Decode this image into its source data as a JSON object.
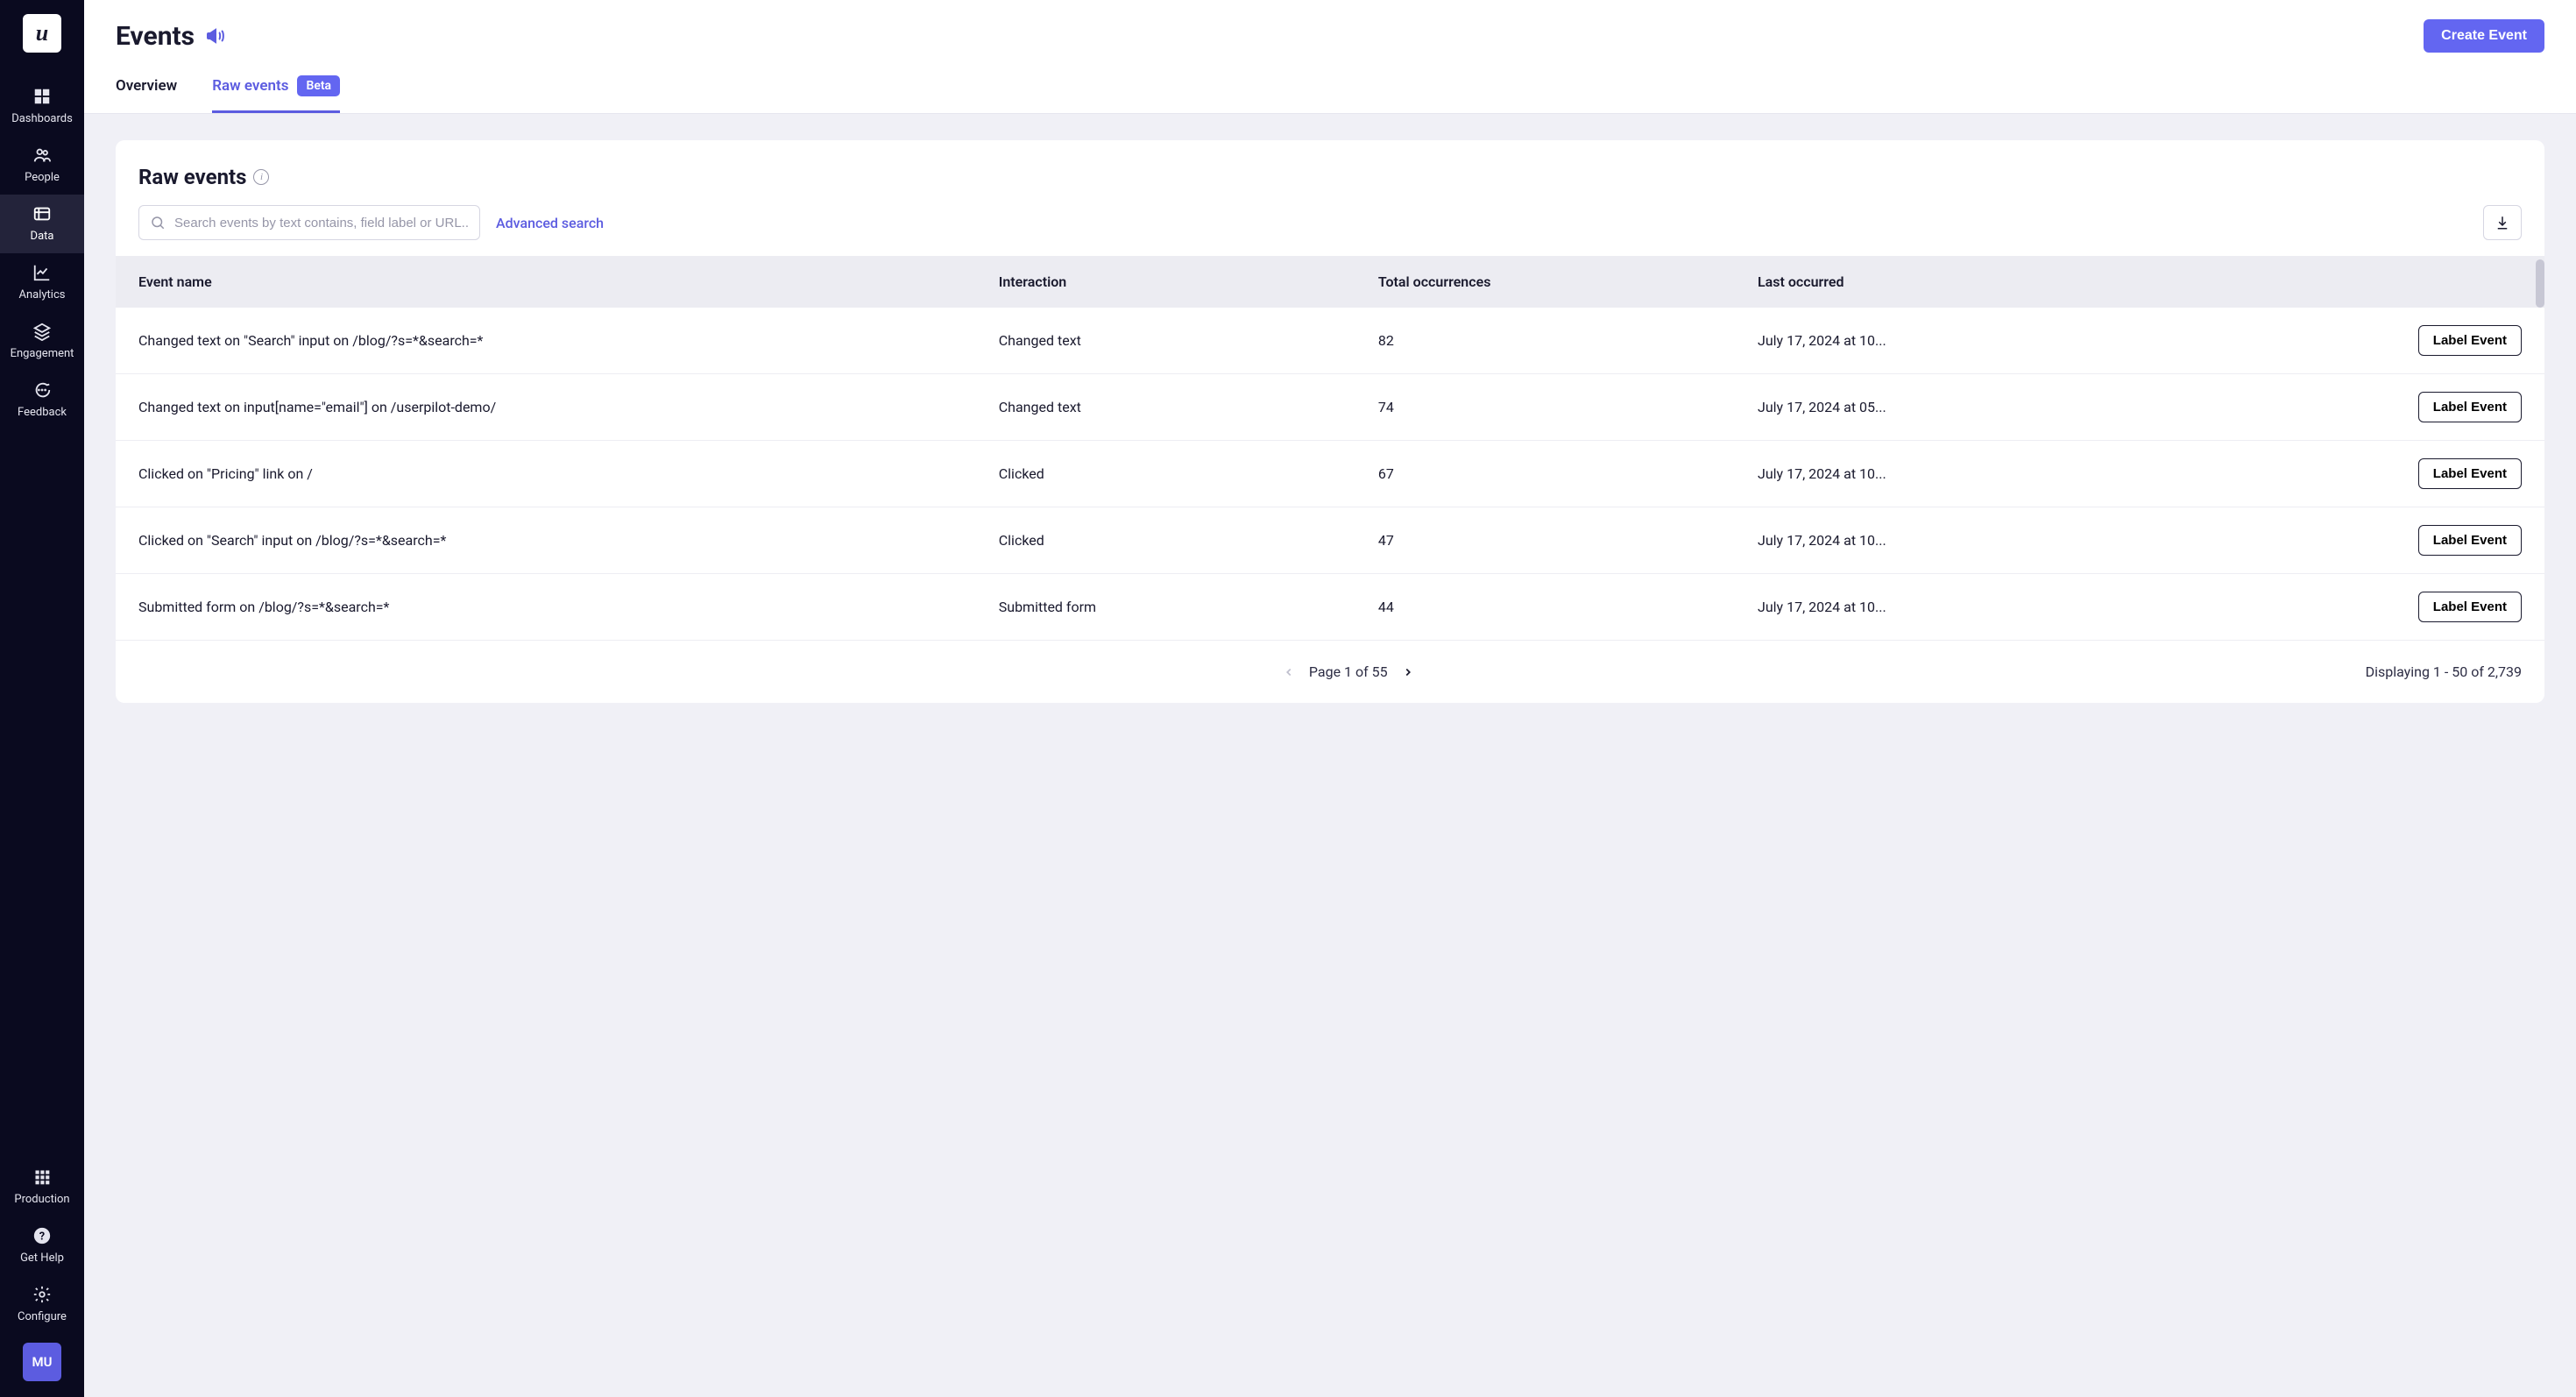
{
  "brand": {
    "logo_letter": "u"
  },
  "sidebar": {
    "items": [
      {
        "id": "dashboards",
        "label": "Dashboards"
      },
      {
        "id": "people",
        "label": "People"
      },
      {
        "id": "data",
        "label": "Data"
      },
      {
        "id": "analytics",
        "label": "Analytics"
      },
      {
        "id": "engagement",
        "label": "Engagement"
      },
      {
        "id": "feedback",
        "label": "Feedback"
      }
    ],
    "active": "data",
    "bottom_items": [
      {
        "id": "production",
        "label": "Production"
      },
      {
        "id": "get-help",
        "label": "Get Help"
      },
      {
        "id": "configure",
        "label": "Configure"
      }
    ],
    "avatar_initials": "MU"
  },
  "header": {
    "title": "Events",
    "create_button": "Create Event",
    "tabs": [
      {
        "id": "overview",
        "label": "Overview",
        "active": false,
        "badge": null
      },
      {
        "id": "raw-events",
        "label": "Raw events",
        "active": true,
        "badge": "Beta"
      }
    ]
  },
  "card": {
    "title": "Raw events",
    "search_placeholder": "Search events by text contains, field label or URL...",
    "advanced_search": "Advanced search",
    "columns": {
      "name": "Event name",
      "interaction": "Interaction",
      "occurrences": "Total occurrences",
      "last": "Last occurred"
    },
    "rows": [
      {
        "name": "Changed text on \"Search\" input on /blog/?s=*&search=*",
        "interaction": "Changed text",
        "occurrences": "82",
        "last": "July 17, 2024 at 10...",
        "action": "Label Event"
      },
      {
        "name": "Changed text on input[name=\"email\"] on /userpilot-demo/",
        "interaction": "Changed text",
        "occurrences": "74",
        "last": "July 17, 2024 at 05...",
        "action": "Label Event"
      },
      {
        "name": "Clicked on \"Pricing\" link on /",
        "interaction": "Clicked",
        "occurrences": "67",
        "last": "July 17, 2024 at 10...",
        "action": "Label Event"
      },
      {
        "name": "Clicked on \"Search\" input on /blog/?s=*&search=*",
        "interaction": "Clicked",
        "occurrences": "47",
        "last": "July 17, 2024 at 10...",
        "action": "Label Event"
      },
      {
        "name": "Submitted form on /blog/?s=*&search=*",
        "interaction": "Submitted form",
        "occurrences": "44",
        "last": "July 17, 2024 at 10...",
        "action": "Label Event"
      }
    ],
    "pager": "Page 1 of 55",
    "displaying": "Displaying 1 - 50 of 2,739"
  },
  "colors": {
    "accent": "#6366f1",
    "sidebar_bg": "#0a0a1f"
  }
}
